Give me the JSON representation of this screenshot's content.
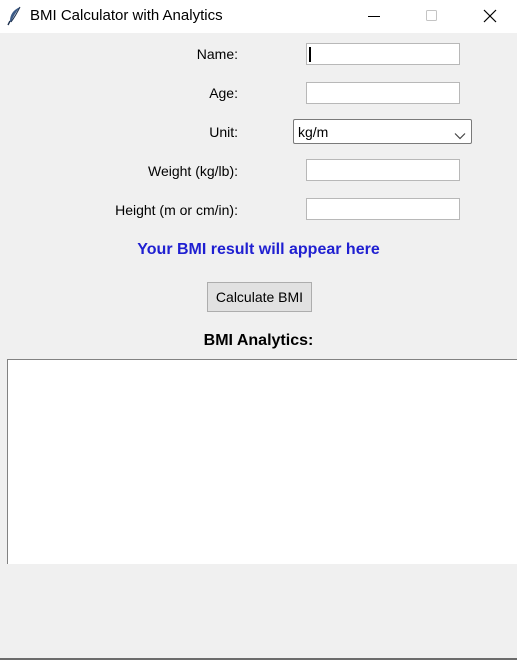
{
  "window": {
    "title": "BMI Calculator with Analytics",
    "app_icon": "feather-icon",
    "controls": [
      "minimize-icon",
      "maximize-icon",
      "close-icon"
    ]
  },
  "form": {
    "name_label": "Name:",
    "name_value": "",
    "age_label": "Age:",
    "age_value": "",
    "unit_label": "Unit:",
    "unit_value": "kg/m",
    "weight_label": "Weight (kg/lb):",
    "weight_value": "",
    "height_label": "Height (m or cm/in):",
    "height_value": ""
  },
  "result_text": "Your BMI result will appear here",
  "calculate_label": "Calculate BMI",
  "analytics": {
    "heading": "BMI Analytics:",
    "content": ""
  },
  "colors": {
    "result": "#1f1fd1",
    "background": "#f0f0f0"
  }
}
